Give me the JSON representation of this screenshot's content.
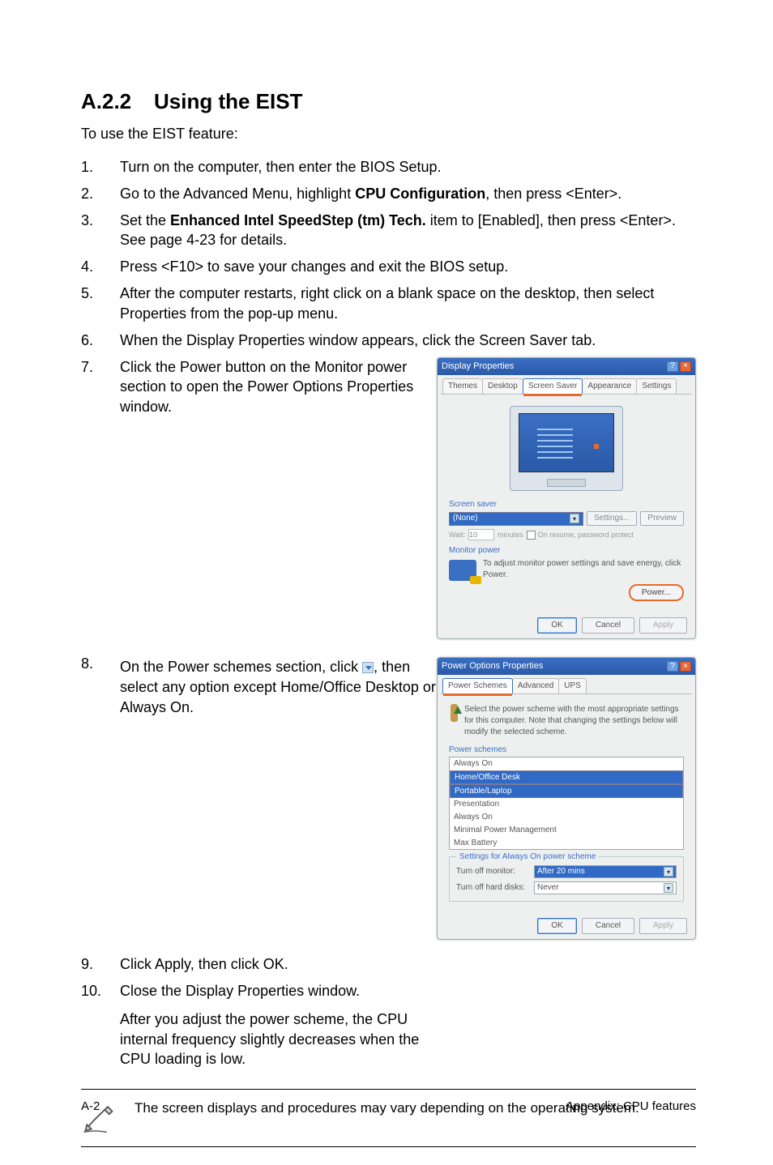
{
  "heading": {
    "num": "A.2.2",
    "title": "Using the EIST"
  },
  "lead": "To use the EIST feature:",
  "steps": {
    "s1": "Turn on the computer, then enter the BIOS Setup.",
    "s2a": "Go to the Advanced Menu, highlight ",
    "s2b": "CPU Configuration",
    "s2c": ", then press <Enter>.",
    "s3a": "Set the ",
    "s3b": "Enhanced Intel SpeedStep (tm) Tech.",
    "s3c": " item to [Enabled], then press <Enter>. See page 4-23 for details.",
    "s4": "Press <F10> to save your changes and exit the BIOS setup.",
    "s5": "After the computer restarts, right click on a blank space on the desktop, then select Properties from the pop-up menu.",
    "s6": "When the Display Properties window appears, click the Screen Saver tab.",
    "s7": "Click the Power button on the Monitor power section to open the Power Options Properties window.",
    "s8a": "On the Power schemes section, click ",
    "s8b": ", then select any option except Home/Office Desktop or Always On.",
    "s9": "Click Apply, then click OK.",
    "s10": "Close the Display Properties window.",
    "s10b": "After you adjust the power scheme, the CPU internal frequency slightly decreases when the CPU loading is low."
  },
  "display_dlg": {
    "title": "Display Properties",
    "tabs": [
      "Themes",
      "Desktop",
      "Screen Saver",
      "Appearance",
      "Settings"
    ],
    "ss_label": "Screen saver",
    "ss_value": "(None)",
    "btn_settings": "Settings...",
    "btn_preview": "Preview",
    "wait_label": "Wait:",
    "wait_minutes": "minutes",
    "resume_label": "On resume, password protect",
    "mp_label": "Monitor power",
    "mp_text": "To adjust monitor power settings and save energy, click Power.",
    "btn_power": "Power...",
    "ok": "OK",
    "cancel": "Cancel",
    "apply": "Apply"
  },
  "power_dlg": {
    "title": "Power Options Properties",
    "tabs": [
      "Power Schemes",
      "Advanced",
      "UPS"
    ],
    "info": "Select the power scheme with the most appropriate settings for this computer. Note that changing the settings below will modify the selected scheme.",
    "group_label": "Power schemes",
    "options": [
      "Always On",
      "Home/Office Desk",
      "Portable/Laptop",
      "Presentation",
      "Always On",
      "Minimal Power Management",
      "Max Battery"
    ],
    "settings_group": "Settings for Always On power scheme",
    "turn_off_monitor": "Turn off monitor:",
    "turn_off_monitor_val": "After 20 mins",
    "turn_off_hd": "Turn off hard disks:",
    "turn_off_hd_val": "Never",
    "ok": "OK",
    "cancel": "Cancel",
    "apply": "Apply"
  },
  "note": "The screen displays and procedures may vary depending on the operating system.",
  "footer": {
    "left": "A-2",
    "right": "Appendix: CPU features"
  }
}
